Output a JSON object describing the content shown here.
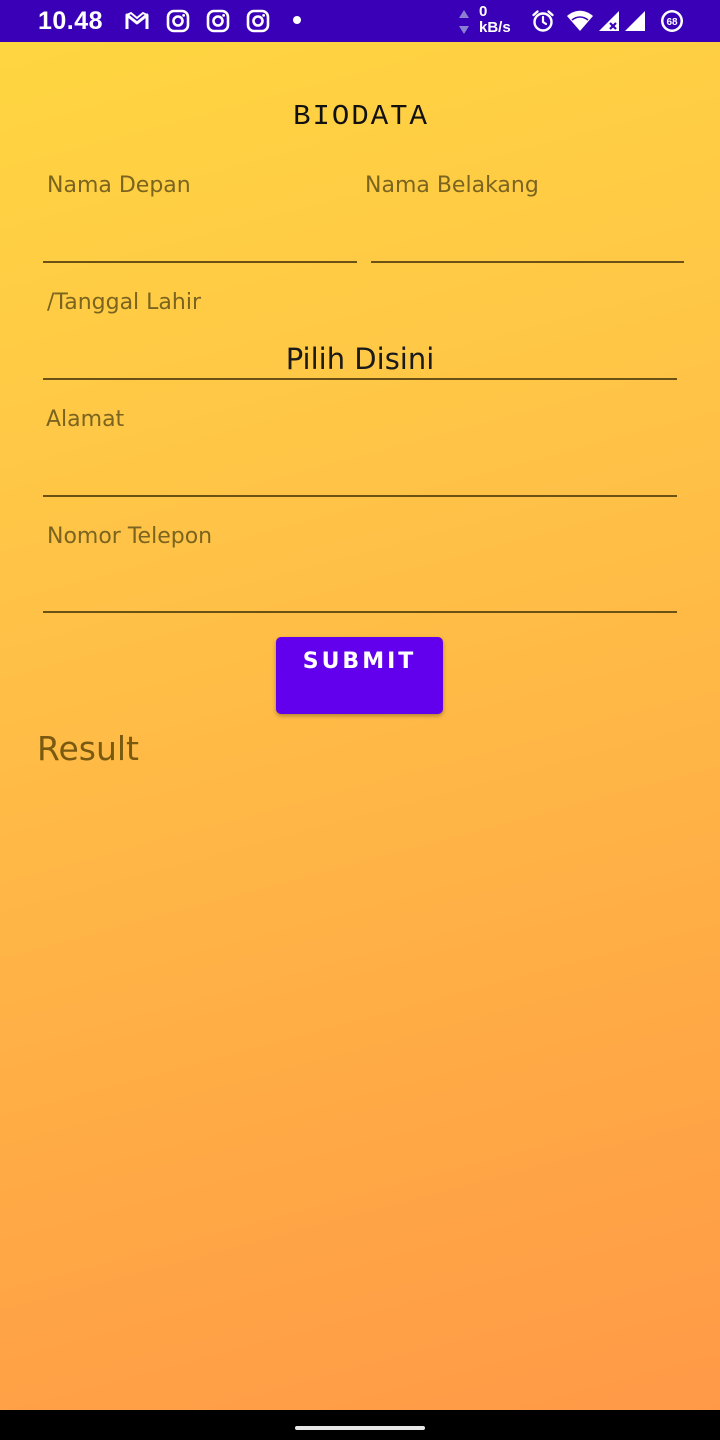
{
  "status_bar": {
    "time": "10.48",
    "network_speed_value": "0",
    "network_speed_unit": "kB/s",
    "battery_level": "68",
    "background_color": "#3A00B8",
    "icons": [
      "gmail-icon",
      "instagram-icon",
      "instagram-icon",
      "instagram-icon",
      "notification-dot-icon",
      "network-arrows-icon",
      "alarm-icon",
      "wifi-icon",
      "signal-icon",
      "signal-icon",
      "battery-icon"
    ]
  },
  "form": {
    "title": "BIODATA",
    "first_name": {
      "label": "Nama Depan",
      "value": ""
    },
    "last_name": {
      "label": "Nama Belakang",
      "value": ""
    },
    "birth_date": {
      "label": "/Tanggal Lahir",
      "value": "Pilih Disini"
    },
    "address": {
      "label": "Alamat",
      "value": ""
    },
    "phone": {
      "label": "Nomor Telepon",
      "value": ""
    },
    "submit_label": "SUBMIT"
  },
  "result": {
    "text": "Result"
  },
  "colors": {
    "accent": "#6200EE",
    "gradient_top": "#FFD740",
    "gradient_bottom": "#FF9848",
    "underline": "#6B5214"
  }
}
